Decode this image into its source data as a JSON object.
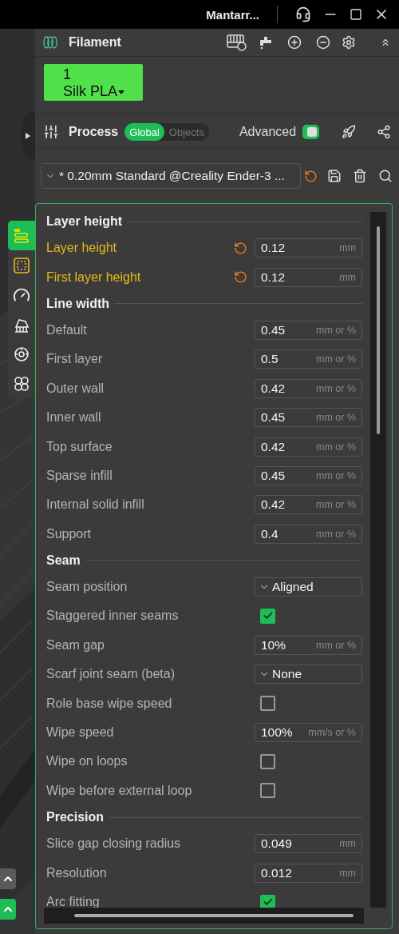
{
  "window": {
    "title": "Mantarr..."
  },
  "filament": {
    "title": "Filament",
    "slots": [
      {
        "number": "1",
        "name": "Silk PLA",
        "color": "#4fe04a"
      }
    ]
  },
  "process": {
    "title": "Process",
    "scope_tabs": [
      {
        "label": "Global",
        "selected": true
      },
      {
        "label": "Objects",
        "selected": false
      }
    ],
    "advanced_label": "Advanced",
    "advanced": true
  },
  "preset": {
    "value": "* 0.20mm Standard @Creality Ender-3 ...",
    "modified": true
  },
  "side_tools": [
    {
      "selected": true
    },
    {
      "selected": false,
      "highlighted": true
    },
    {
      "selected": false,
      "highlighted": false
    },
    {
      "selected": false,
      "highlighted": false
    },
    {
      "selected": false,
      "highlighted": false
    },
    {
      "selected": false,
      "highlighted": false
    }
  ],
  "sections": [
    {
      "title": "Layer height",
      "items": [
        {
          "kind": "number",
          "label": "Layer height",
          "value": "0.12",
          "unit": "mm",
          "modified": true
        },
        {
          "kind": "number",
          "label": "First layer height",
          "value": "0.12",
          "unit": "mm",
          "modified": true
        }
      ]
    },
    {
      "title": "Line width",
      "items": [
        {
          "kind": "number",
          "label": "Default",
          "value": "0.45",
          "unit": "mm or %",
          "modified": false
        },
        {
          "kind": "number",
          "label": "First layer",
          "value": "0.5",
          "unit": "mm or %",
          "modified": false
        },
        {
          "kind": "number",
          "label": "Outer wall",
          "value": "0.42",
          "unit": "mm or %",
          "modified": false
        },
        {
          "kind": "number",
          "label": "Inner wall",
          "value": "0.45",
          "unit": "mm or %",
          "modified": false
        },
        {
          "kind": "number",
          "label": "Top surface",
          "value": "0.42",
          "unit": "mm or %",
          "modified": false
        },
        {
          "kind": "number",
          "label": "Sparse infill",
          "value": "0.45",
          "unit": "mm or %",
          "modified": false
        },
        {
          "kind": "number",
          "label": "Internal solid infill",
          "value": "0.42",
          "unit": "mm or %",
          "modified": false
        },
        {
          "kind": "number",
          "label": "Support",
          "value": "0.4",
          "unit": "mm or %",
          "modified": false
        }
      ]
    },
    {
      "title": "Seam",
      "items": [
        {
          "kind": "select",
          "label": "Seam position",
          "value": "Aligned"
        },
        {
          "kind": "checkbox",
          "label": "Staggered inner seams",
          "checked": true
        },
        {
          "kind": "number",
          "label": "Seam gap",
          "value": "10%",
          "unit": "mm or %",
          "modified": false
        },
        {
          "kind": "select",
          "label": "Scarf joint seam (beta)",
          "value": "None"
        },
        {
          "kind": "checkbox",
          "label": "Role base wipe speed",
          "checked": false
        },
        {
          "kind": "number",
          "label": "Wipe speed",
          "value": "100%",
          "unit": "mm/s or %",
          "modified": false
        },
        {
          "kind": "checkbox",
          "label": "Wipe on loops",
          "checked": false
        },
        {
          "kind": "checkbox",
          "label": "Wipe before external loop",
          "checked": false
        }
      ]
    },
    {
      "title": "Precision",
      "items": [
        {
          "kind": "number",
          "label": "Slice gap closing radius",
          "value": "0.049",
          "unit": "mm",
          "modified": false
        },
        {
          "kind": "number",
          "label": "Resolution",
          "value": "0.012",
          "unit": "mm",
          "modified": false
        },
        {
          "kind": "checkbox",
          "label": "Arc fitting",
          "checked": true
        }
      ]
    }
  ]
}
